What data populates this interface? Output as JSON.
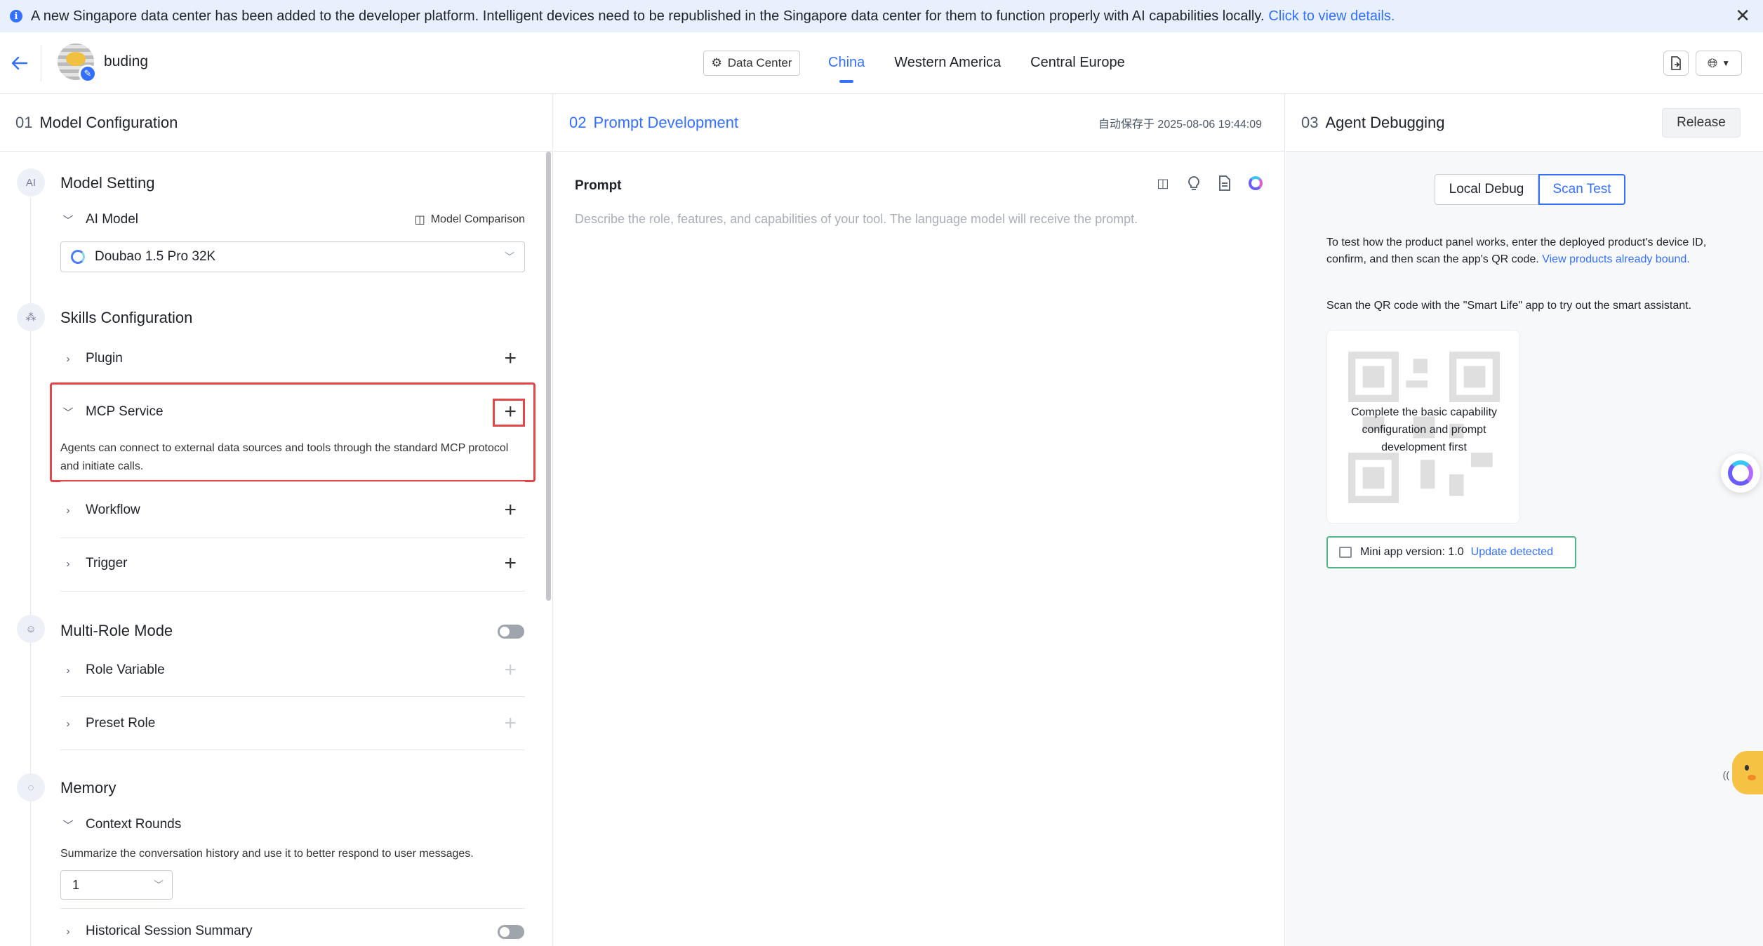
{
  "banner": {
    "message": "A new Singapore data center has been added to the developer platform. Intelligent devices need to be republished in the Singapore data center for them to function properly with AI capabilities locally.",
    "link": "Click to view details."
  },
  "header": {
    "agent_name": "buding",
    "data_center_label": "Data Center",
    "tabs": [
      "China",
      "Western America",
      "Central Europe"
    ],
    "active_tab": "China"
  },
  "left": {
    "step": "01",
    "title": "Model Configuration",
    "model_setting": {
      "title": "Model Setting",
      "ai_model_label": "AI Model",
      "model_comparison": "Model Comparison",
      "selected_model": "Doubao 1.5 Pro 32K"
    },
    "skills": {
      "title": "Skills Configuration",
      "plugin": "Plugin",
      "mcp_service": "MCP Service",
      "mcp_desc": "Agents can connect to external data sources and tools through the standard MCP protocol and initiate calls.",
      "workflow": "Workflow",
      "trigger": "Trigger"
    },
    "multi_role": {
      "title": "Multi-Role Mode",
      "role_variable": "Role Variable",
      "preset_role": "Preset Role"
    },
    "memory": {
      "title": "Memory",
      "context_rounds": "Context Rounds",
      "context_desc": "Summarize the conversation history and use it to better respond to user messages.",
      "rounds_value": "1",
      "historical_summary": "Historical Session Summary"
    }
  },
  "mid": {
    "step": "02",
    "title": "Prompt Development",
    "autosave": "自动保存于 2025-08-06 19:44:09",
    "prompt_label": "Prompt",
    "prompt_placeholder": "Describe the role, features, and capabilities of your tool. The language model will receive the prompt."
  },
  "right": {
    "step": "03",
    "title": "Agent Debugging",
    "release": "Release",
    "local_debug": "Local Debug",
    "scan_test": "Scan Test",
    "instr1": "To test how the product panel works, enter the deployed product's device ID, confirm, and then scan the app's QR code.",
    "instr1_link": "View products already bound.",
    "instr2": "Scan the QR code with the \"Smart Life\" app to try out the smart assistant.",
    "qr_text": "Complete the basic capability configuration and prompt development first",
    "mini_version": "Mini app version: 1.0",
    "update_link": "Update detected"
  },
  "colors": {
    "accent": "#3370ff",
    "highlight": "#e04848",
    "success_border": "#52b788"
  },
  "icons": [
    "info-icon",
    "close-icon",
    "back-arrow-icon",
    "gear-icon",
    "share-icon",
    "globe-icon",
    "chevron-right-icon",
    "chevron-down-icon",
    "plus-icon",
    "ai-icon",
    "skills-icon",
    "roles-icon",
    "memory-icon",
    "compare-icon",
    "split-view-icon",
    "lightbulb-icon",
    "document-icon",
    "ai-assistant-icon",
    "package-icon"
  ]
}
